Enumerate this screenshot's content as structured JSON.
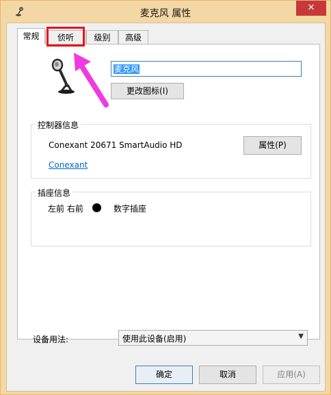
{
  "window": {
    "title": "麦克风 属性",
    "close_label": "✕"
  },
  "tabs": [
    {
      "label": "常规",
      "active": true
    },
    {
      "label": "侦听",
      "active": false
    },
    {
      "label": "级别",
      "active": false
    },
    {
      "label": "高级",
      "active": false
    }
  ],
  "device": {
    "icon": "microphone-icon",
    "name_value": "麦克风",
    "change_icon_label": "更改图标(I)"
  },
  "controller": {
    "group_label": "控制器信息",
    "name": "Conexant 20671 SmartAudio HD",
    "properties_label": "属性(P)",
    "vendor_link": "Conexant"
  },
  "jack": {
    "group_label": "插座信息",
    "position": "左前 右前",
    "jack_color": "#000000",
    "type": "数字插座"
  },
  "usage": {
    "label": "设备用法:",
    "selected": "使用此设备(启用)"
  },
  "footer": {
    "ok_label": "确定",
    "cancel_label": "取消",
    "apply_label": "应用(A)"
  },
  "annotation": {
    "color": "#e8141b",
    "arrow_color": "#f03ae0"
  }
}
